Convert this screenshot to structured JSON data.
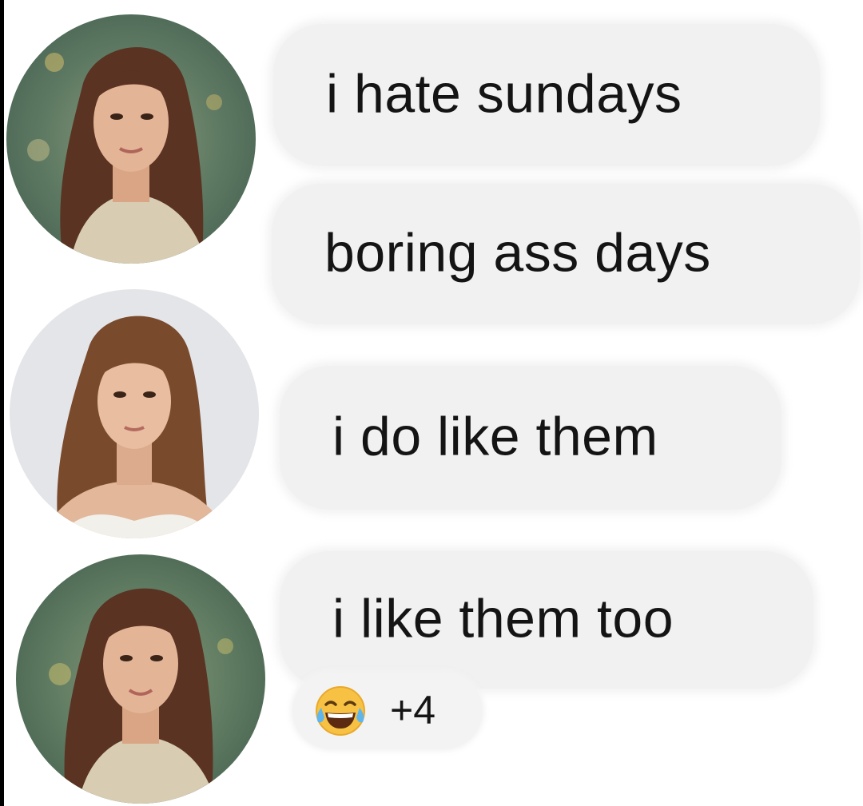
{
  "messages": [
    {
      "text": "i hate sundays"
    },
    {
      "text": "boring ass days"
    },
    {
      "text": "i do like them"
    },
    {
      "text": "i like them too"
    }
  ],
  "reaction": {
    "emoji": "face-with-tears-of-joy",
    "count": "+4"
  },
  "colors": {
    "bubble": "#f1f1f1",
    "text": "#141414",
    "background": "#ffffff"
  }
}
